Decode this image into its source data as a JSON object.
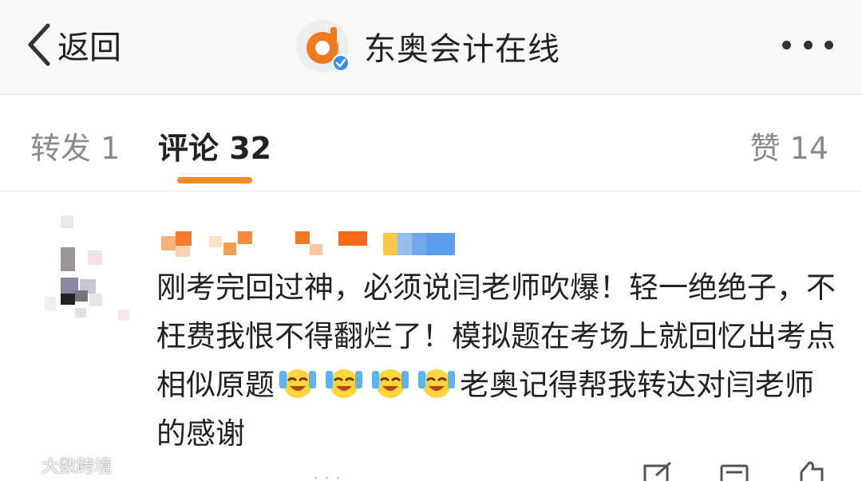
{
  "topbar": {
    "back_label": "返回",
    "account_name": "东奥会计在线",
    "back_icon": "chevron-left-icon",
    "more_icon": "more-dots-icon",
    "verified_icon": "verified-badge-icon"
  },
  "tabs": [
    {
      "label": "转发 1"
    },
    {
      "label": "评论 32"
    },
    {
      "label": "赞 14"
    }
  ],
  "colors": {
    "accent": "#f88a24",
    "text": "#222222",
    "muted": "#8a8a8a",
    "verified": "#3a8fe8"
  },
  "comment": {
    "text": "刚考完回过神，必须说闫老师吹爆！轻一绝绝子，不枉费我恨不得翻烂了！模拟题在考场上就回忆出考点相似原题",
    "text_after_emoji": "老奥记得帮我转达对闫老师的感谢",
    "emoji_icon": "laughing-crying-emoji-icon",
    "emoji_count": 4
  },
  "watermark": {
    "text": "大数跨境"
  }
}
